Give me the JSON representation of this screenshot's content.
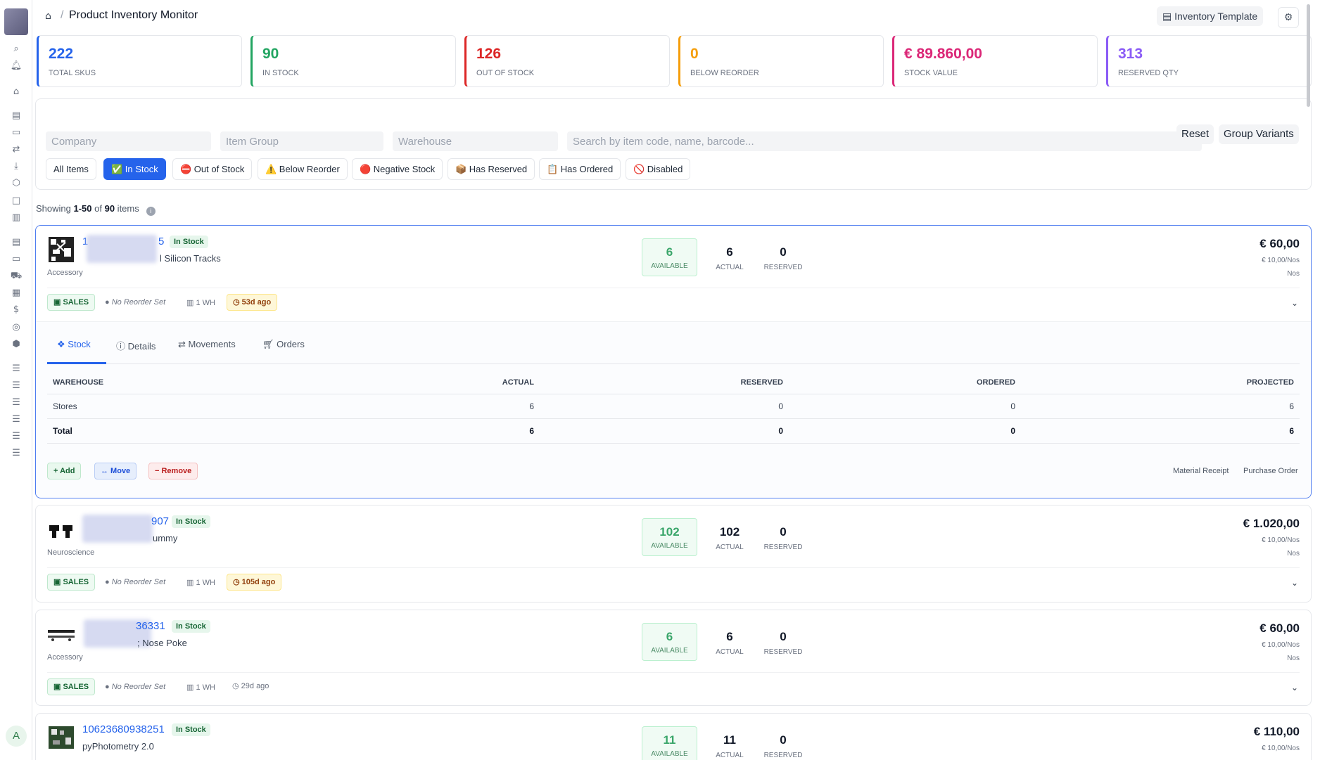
{
  "header": {
    "title": "Product Inventory Monitor",
    "separator": "/",
    "template_label": "Inventory Template"
  },
  "sidebar": {
    "avatar_letter": "A"
  },
  "stats": [
    {
      "value": "222",
      "label": "TOTAL SKUS",
      "color": "#2563eb"
    },
    {
      "value": "90",
      "label": "IN STOCK",
      "color": "#22a561"
    },
    {
      "value": "126",
      "label": "OUT OF STOCK",
      "color": "#dc2626"
    },
    {
      "value": "0",
      "label": "BELOW REORDER",
      "color": "#f59e0b"
    },
    {
      "value": "€ 89.860,00",
      "label": "STOCK VALUE",
      "color": "#db2777"
    },
    {
      "value": "313",
      "label": "RESERVED QTY",
      "color": "#8b5cf6"
    }
  ],
  "filters": {
    "company_placeholder": "Company",
    "item_group_placeholder": "Item Group",
    "warehouse_placeholder": "Warehouse",
    "search_placeholder": "Search by item code, name, barcode...",
    "reset_label": "Reset",
    "group_variants_label": "Group Variants",
    "chips": [
      "All Items",
      "✅ In Stock",
      "⛔ Out of Stock",
      "⚠️ Below Reorder",
      "🔴 Negative Stock",
      "📦 Has Reserved",
      "📋 Has Ordered",
      "🚫 Disabled"
    ]
  },
  "showing": {
    "prefix": "Showing ",
    "range": "1-50",
    "of": " of ",
    "total": "90",
    "suffix": " items"
  },
  "labels": {
    "available": "AVAILABLE",
    "actual": "ACTUAL",
    "reserved": "RESERVED",
    "sales": "SALES",
    "no_reorder": "No Reorder Set",
    "wh": "1 WH",
    "in_stock": "In Stock"
  },
  "items": [
    {
      "code_start": "1",
      "code_end": "5",
      "name_visible": "l Silicon Tracks",
      "group": "Accessory",
      "available": "6",
      "actual": "6",
      "reserved": "0",
      "price": "€ 60,00",
      "unit_price": "€ 10,00/Nos",
      "uom": "Nos",
      "ago": "53d ago"
    },
    {
      "code_start": "",
      "code_end": "907",
      "name_visible": "ummy",
      "group": "Neuroscience",
      "available": "102",
      "actual": "102",
      "reserved": "0",
      "price": "€ 1.020,00",
      "unit_price": "€ 10,00/Nos",
      "uom": "Nos",
      "ago": "105d ago"
    },
    {
      "code_start": "",
      "code_end": "36331",
      "name_visible": "; Nose Poke",
      "group": "Accessory",
      "available": "6",
      "actual": "6",
      "reserved": "0",
      "price": "€ 60,00",
      "unit_price": "€ 10,00/Nos",
      "uom": "Nos",
      "ago": "29d ago"
    },
    {
      "code_start": "10623680938251",
      "code_end": "",
      "name_visible": "pyPhotometry 2.0",
      "group": "",
      "available": "11",
      "actual": "11",
      "reserved": "0",
      "price": "€ 110,00",
      "unit_price": "€ 10,00/Nos",
      "uom": "",
      "ago": ""
    }
  ],
  "detail": {
    "tabs": [
      "Stock",
      "Details",
      "Movements",
      "Orders"
    ],
    "columns": [
      "WAREHOUSE",
      "ACTUAL",
      "RESERVED",
      "ORDERED",
      "PROJECTED"
    ],
    "rows": [
      {
        "warehouse": "Stores",
        "actual": "6",
        "reserved": "0",
        "ordered": "0",
        "projected": "6"
      }
    ],
    "total": {
      "warehouse": "Total",
      "actual": "6",
      "reserved": "0",
      "ordered": "0",
      "projected": "6"
    },
    "add_label": "+ Add",
    "move_label": "↔ Move",
    "remove_label": "− Remove",
    "links": [
      "Material Receipt",
      "Purchase Order"
    ]
  }
}
